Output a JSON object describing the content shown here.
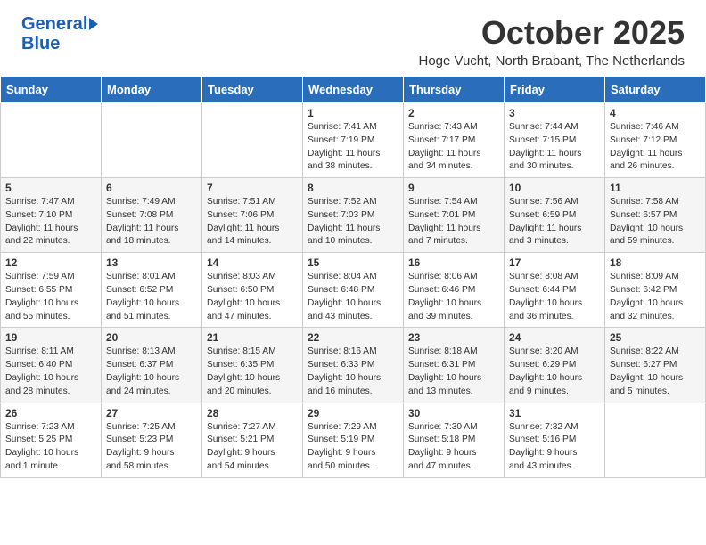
{
  "header": {
    "logo_line1": "General",
    "logo_line2": "Blue",
    "month_title": "October 2025",
    "subtitle": "Hoge Vucht, North Brabant, The Netherlands"
  },
  "weekdays": [
    "Sunday",
    "Monday",
    "Tuesday",
    "Wednesday",
    "Thursday",
    "Friday",
    "Saturday"
  ],
  "weeks": [
    [
      {
        "num": "",
        "info": ""
      },
      {
        "num": "",
        "info": ""
      },
      {
        "num": "",
        "info": ""
      },
      {
        "num": "1",
        "info": "Sunrise: 7:41 AM\nSunset: 7:19 PM\nDaylight: 11 hours\nand 38 minutes."
      },
      {
        "num": "2",
        "info": "Sunrise: 7:43 AM\nSunset: 7:17 PM\nDaylight: 11 hours\nand 34 minutes."
      },
      {
        "num": "3",
        "info": "Sunrise: 7:44 AM\nSunset: 7:15 PM\nDaylight: 11 hours\nand 30 minutes."
      },
      {
        "num": "4",
        "info": "Sunrise: 7:46 AM\nSunset: 7:12 PM\nDaylight: 11 hours\nand 26 minutes."
      }
    ],
    [
      {
        "num": "5",
        "info": "Sunrise: 7:47 AM\nSunset: 7:10 PM\nDaylight: 11 hours\nand 22 minutes."
      },
      {
        "num": "6",
        "info": "Sunrise: 7:49 AM\nSunset: 7:08 PM\nDaylight: 11 hours\nand 18 minutes."
      },
      {
        "num": "7",
        "info": "Sunrise: 7:51 AM\nSunset: 7:06 PM\nDaylight: 11 hours\nand 14 minutes."
      },
      {
        "num": "8",
        "info": "Sunrise: 7:52 AM\nSunset: 7:03 PM\nDaylight: 11 hours\nand 10 minutes."
      },
      {
        "num": "9",
        "info": "Sunrise: 7:54 AM\nSunset: 7:01 PM\nDaylight: 11 hours\nand 7 minutes."
      },
      {
        "num": "10",
        "info": "Sunrise: 7:56 AM\nSunset: 6:59 PM\nDaylight: 11 hours\nand 3 minutes."
      },
      {
        "num": "11",
        "info": "Sunrise: 7:58 AM\nSunset: 6:57 PM\nDaylight: 10 hours\nand 59 minutes."
      }
    ],
    [
      {
        "num": "12",
        "info": "Sunrise: 7:59 AM\nSunset: 6:55 PM\nDaylight: 10 hours\nand 55 minutes."
      },
      {
        "num": "13",
        "info": "Sunrise: 8:01 AM\nSunset: 6:52 PM\nDaylight: 10 hours\nand 51 minutes."
      },
      {
        "num": "14",
        "info": "Sunrise: 8:03 AM\nSunset: 6:50 PM\nDaylight: 10 hours\nand 47 minutes."
      },
      {
        "num": "15",
        "info": "Sunrise: 8:04 AM\nSunset: 6:48 PM\nDaylight: 10 hours\nand 43 minutes."
      },
      {
        "num": "16",
        "info": "Sunrise: 8:06 AM\nSunset: 6:46 PM\nDaylight: 10 hours\nand 39 minutes."
      },
      {
        "num": "17",
        "info": "Sunrise: 8:08 AM\nSunset: 6:44 PM\nDaylight: 10 hours\nand 36 minutes."
      },
      {
        "num": "18",
        "info": "Sunrise: 8:09 AM\nSunset: 6:42 PM\nDaylight: 10 hours\nand 32 minutes."
      }
    ],
    [
      {
        "num": "19",
        "info": "Sunrise: 8:11 AM\nSunset: 6:40 PM\nDaylight: 10 hours\nand 28 minutes."
      },
      {
        "num": "20",
        "info": "Sunrise: 8:13 AM\nSunset: 6:37 PM\nDaylight: 10 hours\nand 24 minutes."
      },
      {
        "num": "21",
        "info": "Sunrise: 8:15 AM\nSunset: 6:35 PM\nDaylight: 10 hours\nand 20 minutes."
      },
      {
        "num": "22",
        "info": "Sunrise: 8:16 AM\nSunset: 6:33 PM\nDaylight: 10 hours\nand 16 minutes."
      },
      {
        "num": "23",
        "info": "Sunrise: 8:18 AM\nSunset: 6:31 PM\nDaylight: 10 hours\nand 13 minutes."
      },
      {
        "num": "24",
        "info": "Sunrise: 8:20 AM\nSunset: 6:29 PM\nDaylight: 10 hours\nand 9 minutes."
      },
      {
        "num": "25",
        "info": "Sunrise: 8:22 AM\nSunset: 6:27 PM\nDaylight: 10 hours\nand 5 minutes."
      }
    ],
    [
      {
        "num": "26",
        "info": "Sunrise: 7:23 AM\nSunset: 5:25 PM\nDaylight: 10 hours\nand 1 minute."
      },
      {
        "num": "27",
        "info": "Sunrise: 7:25 AM\nSunset: 5:23 PM\nDaylight: 9 hours\nand 58 minutes."
      },
      {
        "num": "28",
        "info": "Sunrise: 7:27 AM\nSunset: 5:21 PM\nDaylight: 9 hours\nand 54 minutes."
      },
      {
        "num": "29",
        "info": "Sunrise: 7:29 AM\nSunset: 5:19 PM\nDaylight: 9 hours\nand 50 minutes."
      },
      {
        "num": "30",
        "info": "Sunrise: 7:30 AM\nSunset: 5:18 PM\nDaylight: 9 hours\nand 47 minutes."
      },
      {
        "num": "31",
        "info": "Sunrise: 7:32 AM\nSunset: 5:16 PM\nDaylight: 9 hours\nand 43 minutes."
      },
      {
        "num": "",
        "info": ""
      }
    ]
  ]
}
